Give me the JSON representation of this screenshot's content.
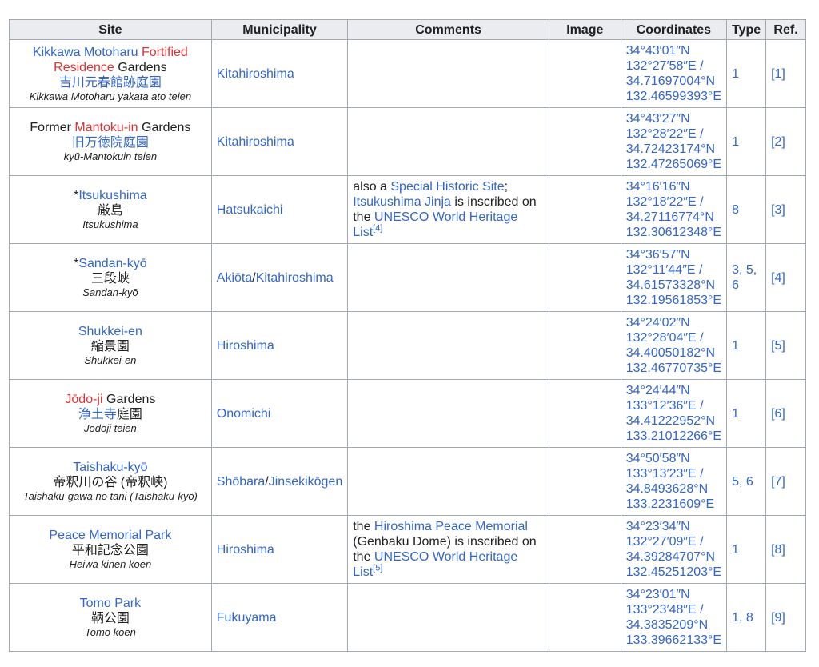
{
  "headers": {
    "site": "Site",
    "municipality": "Municipality",
    "comments": "Comments",
    "image": "Image",
    "coordinates": "Coordinates",
    "type": "Type",
    "ref": "Ref."
  },
  "rows": [
    {
      "site_parts": [
        "Kikkawa Motoharu",
        " ",
        "Fortified Residence",
        " Gardens"
      ],
      "jp": "吉川元春館跡庭園",
      "romaji": "Kikkawa Motoharu yakata ato teien",
      "municipality": "Kitahiroshima",
      "comments": "",
      "coords": [
        "34°43′01″N",
        "132°27′58″E /",
        "34.71697004°N",
        "132.46599393°E"
      ],
      "type": "1",
      "ref": "[1]"
    },
    {
      "site_parts": [
        "Former ",
        "Mantoku-in",
        " Gardens"
      ],
      "jp": "旧万徳院庭園",
      "romaji": "kyū-Mantokuin teien",
      "municipality": "Kitahiroshima",
      "comments": "",
      "coords": [
        "34°43′27″N",
        "132°28′22″E /",
        "34.72423174°N",
        "132.47265069°E"
      ],
      "type": "1",
      "ref": "[2]"
    },
    {
      "site_prefix": "*",
      "site_link": "Itsukushima",
      "jp": "厳島",
      "romaji": "Itsukushima",
      "municipality": "Hatsukaichi",
      "comments_parts": [
        "also a ",
        "Special Historic Site",
        "; ",
        "Itsukushima Jinja",
        " is inscribed on the ",
        "UNESCO World Heritage List",
        "[4]"
      ],
      "coords": [
        "34°16′16″N",
        "132°18′22″E /",
        "34.27116774°N",
        "132.30612348°E"
      ],
      "type": "8",
      "ref": "[3]"
    },
    {
      "site_prefix": "*",
      "site_link": "Sandan-kyō",
      "jp": "三段峡",
      "romaji": "Sandan-kyō",
      "municipality_parts": [
        "Akiōta",
        "/",
        "Kitahiroshima"
      ],
      "coords": [
        "34°36′57″N",
        "132°11′44″E /",
        "34.61573328°N",
        "132.19561853°E"
      ],
      "type": "3, 5, 6",
      "ref": "[4]"
    },
    {
      "site_link": "Shukkei-en",
      "jp": "縮景園",
      "romaji": "Shukkei-en",
      "municipality": "Hiroshima",
      "coords": [
        "34°24′02″N",
        "132°28′04″E /",
        "34.40050182°N",
        "132.46770735°E"
      ],
      "type": "1",
      "ref": "[5]"
    },
    {
      "site_parts": [
        "Jōdo-ji",
        " Gardens"
      ],
      "jp_parts": [
        "浄土寺",
        "庭園"
      ],
      "romaji": "Jōdoji teien",
      "municipality": "Onomichi",
      "coords": [
        "34°24′44″N",
        "133°12′36″E /",
        "34.41222952°N",
        "133.21012266°E"
      ],
      "type": "1",
      "ref": "[6]"
    },
    {
      "site_link": "Taishaku-kyō",
      "jp": "帝釈川の谷 (帝釈峡)",
      "romaji": "Taishaku-gawa no tani (Taishaku-kyō)",
      "municipality_parts": [
        "Shōbara",
        "/",
        "Jinsekikōgen"
      ],
      "coords": [
        "34°50′58″N",
        "133°13′23″E /",
        "34.8493628°N",
        "133.2231609°E"
      ],
      "type": "5, 6",
      "ref": "[7]"
    },
    {
      "site_link": "Peace Memorial Park",
      "jp": "平和記念公園",
      "romaji": "Heiwa kinen kōen",
      "municipality": "Hiroshima",
      "comments_parts": [
        "the ",
        "Hiroshima Peace Memorial",
        " (Genbaku Dome) is inscribed on the ",
        "UNESCO World Heritage List",
        "[5]"
      ],
      "coords": [
        "34°23′34″N",
        "132°27′09″E /",
        "34.39284707°N",
        "132.45251203°E"
      ],
      "type": "1",
      "ref": "[8]"
    },
    {
      "site_link": "Tomo Park",
      "jp": "鞆公園",
      "romaji": "Tomo kōen",
      "municipality": "Fukuyama",
      "coords": [
        "34°23′01″N",
        "133°23′48″E /",
        "34.3835209°N",
        "133.39662133°E"
      ],
      "type": "1, 8",
      "ref": "[9]"
    }
  ]
}
